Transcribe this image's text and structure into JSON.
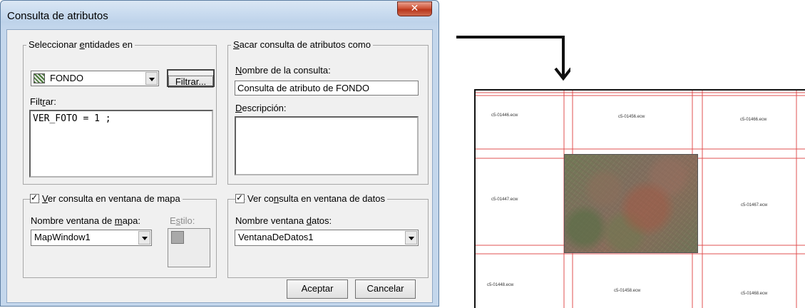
{
  "window": {
    "title": "Consulta de atributos",
    "close_symbol": "✕"
  },
  "select_group": {
    "legend_pre": "Seleccionar ",
    "legend_u": "e",
    "legend_post": "ntidades en",
    "layer_value": "FONDO",
    "layer_icon": "layer-pattern-icon",
    "filter_button": "Filtrar...",
    "filter_label_pre": "Filt",
    "filter_label_u": "r",
    "filter_label_post": "ar:",
    "filter_expression": "VER_FOTO = 1 ;"
  },
  "output_group": {
    "legend_u": "S",
    "legend_post": "acar consulta de atributos como",
    "name_label_u": "N",
    "name_label_post": "ombre de la consulta:",
    "name_value": "Consulta de atributo de FONDO",
    "desc_label_u": "D",
    "desc_label_post": "escripción:",
    "desc_value": ""
  },
  "map_group": {
    "checkbox_u": "V",
    "checkbox_post": "er consulta en ventana de mapa",
    "checked": true,
    "window_label_pre": "Nombre ventana de ",
    "window_label_u": "m",
    "window_label_post": "apa:",
    "window_value": "MapWindow1",
    "style_label_pre": "E",
    "style_label_u": "s",
    "style_label_post": "tilo:"
  },
  "data_group": {
    "checkbox_pre": "Ver co",
    "checkbox_u": "n",
    "checkbox_post": "sulta en ventana de datos",
    "checked": true,
    "window_label_pre": "Nombre ventana ",
    "window_label_u": "d",
    "window_label_post": "atos:",
    "window_value": "VentanaDeDatos1"
  },
  "buttons": {
    "accept": "Aceptar",
    "cancel": "Cancelar"
  },
  "map_tiles": {
    "row1": [
      "c5-01446.ecw",
      "c5-01456.ecw",
      "c5-01466.ecw"
    ],
    "row2": [
      "c5-01447.ecw",
      "c5-01467.ecw"
    ],
    "row3": [
      "c5-01448.ecw",
      "c5-01458.ecw",
      "c5-01468.ecw"
    ],
    "line_color": "#e05050"
  }
}
